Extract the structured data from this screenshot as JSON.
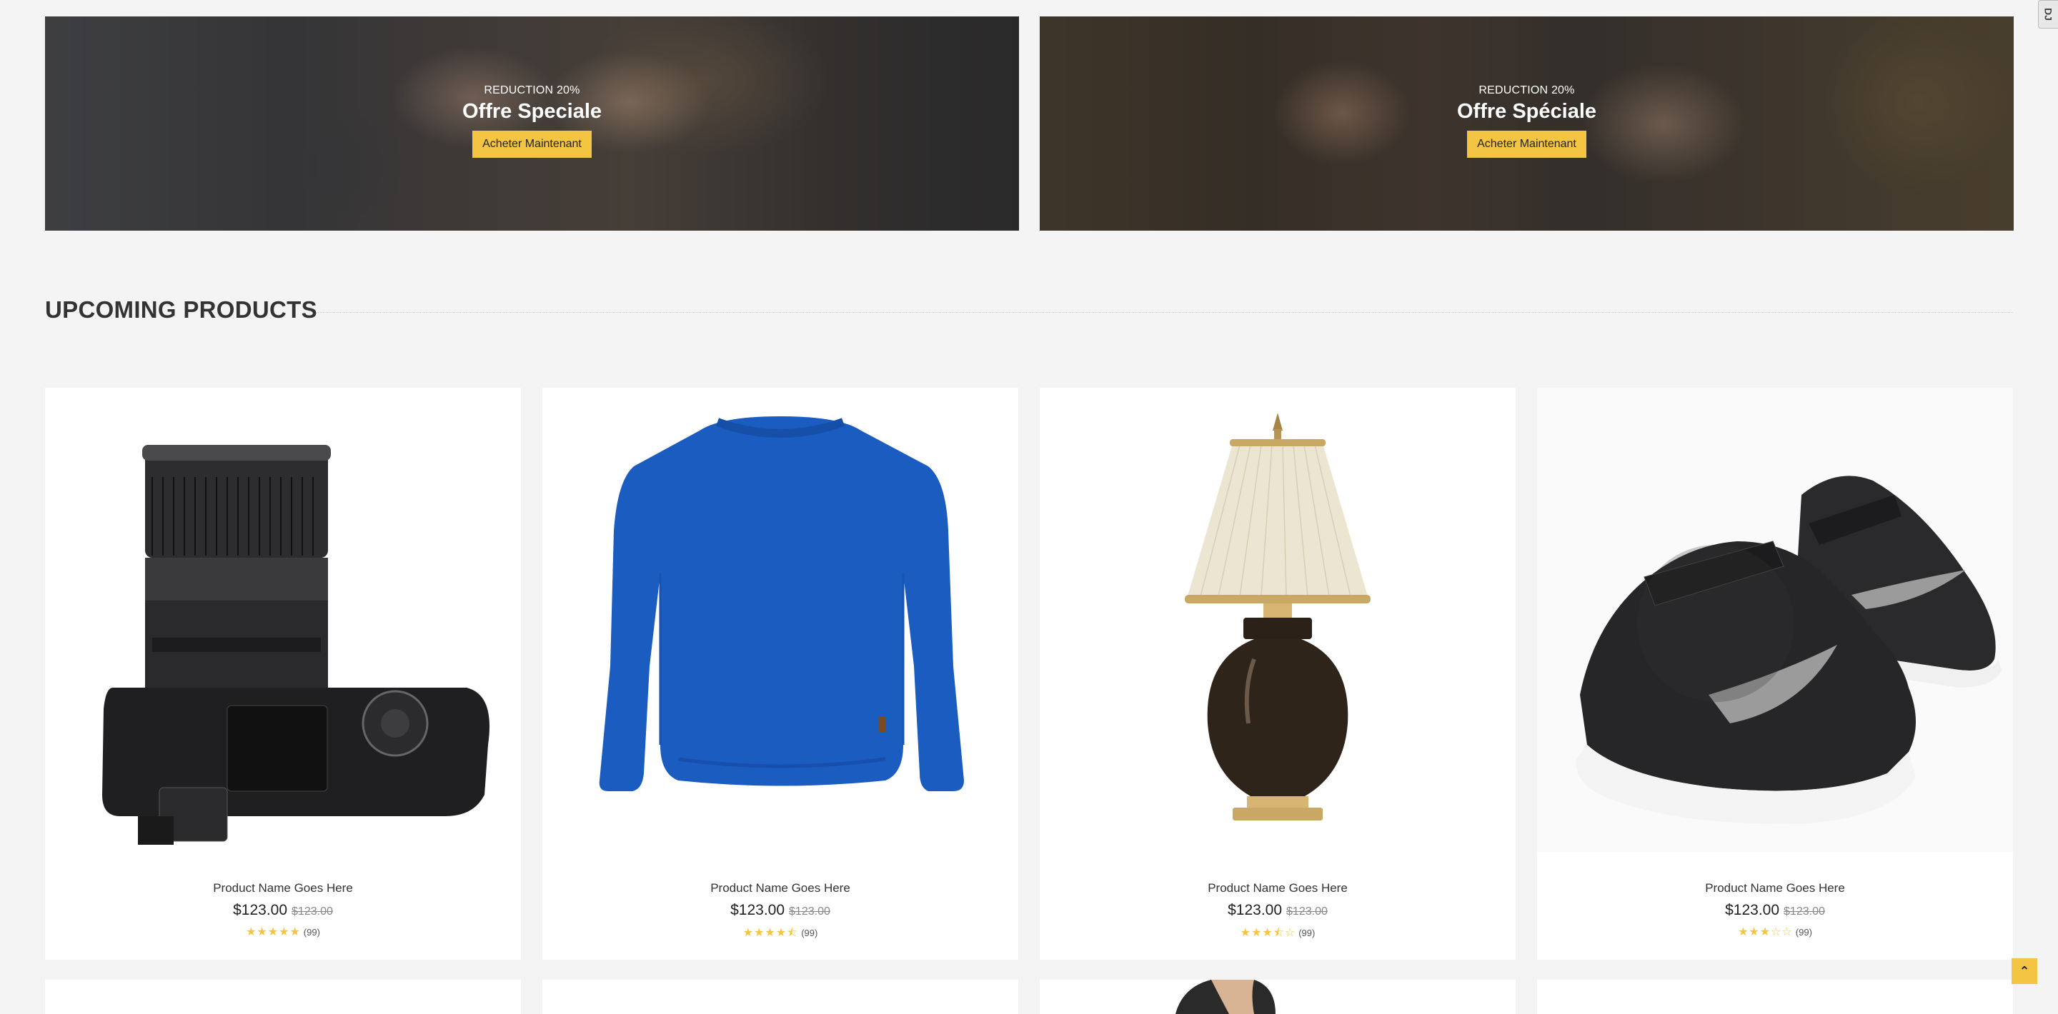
{
  "side_tab": {
    "label": "DJ"
  },
  "banners": [
    {
      "subtitle": "REDUCTION 20%",
      "title": "Offre Speciale",
      "button": "Acheter Maintenant"
    },
    {
      "subtitle": "REDUCTION 20%",
      "title": "Offre Spéciale",
      "button": "Acheter Maintenant"
    }
  ],
  "section": {
    "title": "UPCOMING PRODUCTS"
  },
  "products": [
    {
      "image": "camera",
      "name": "Product Name Goes Here",
      "price": "$123.00",
      "old_price": "$123.00",
      "rating": 5,
      "stars": "★★★★★",
      "count": "(99)"
    },
    {
      "image": "sweater",
      "name": "Product Name Goes Here",
      "price": "$123.00",
      "old_price": "$123.00",
      "rating": 4.5,
      "stars": "★★★★⯪",
      "count": "(99)"
    },
    {
      "image": "lamp",
      "name": "Product Name Goes Here",
      "price": "$123.00",
      "old_price": "$123.00",
      "rating": 3.5,
      "stars": "★★★⯪☆",
      "count": "(99)"
    },
    {
      "image": "sneakers",
      "name": "Product Name Goes Here",
      "price": "$123.00",
      "old_price": "$123.00",
      "rating": 3,
      "stars": "★★★☆☆",
      "count": "(99)"
    }
  ],
  "back_to_top": {
    "icon": "double-chevron-up-icon",
    "glyph": "⌃"
  },
  "colors": {
    "accent": "#f4c542",
    "background": "#f4f4f4",
    "card": "#ffffff"
  }
}
